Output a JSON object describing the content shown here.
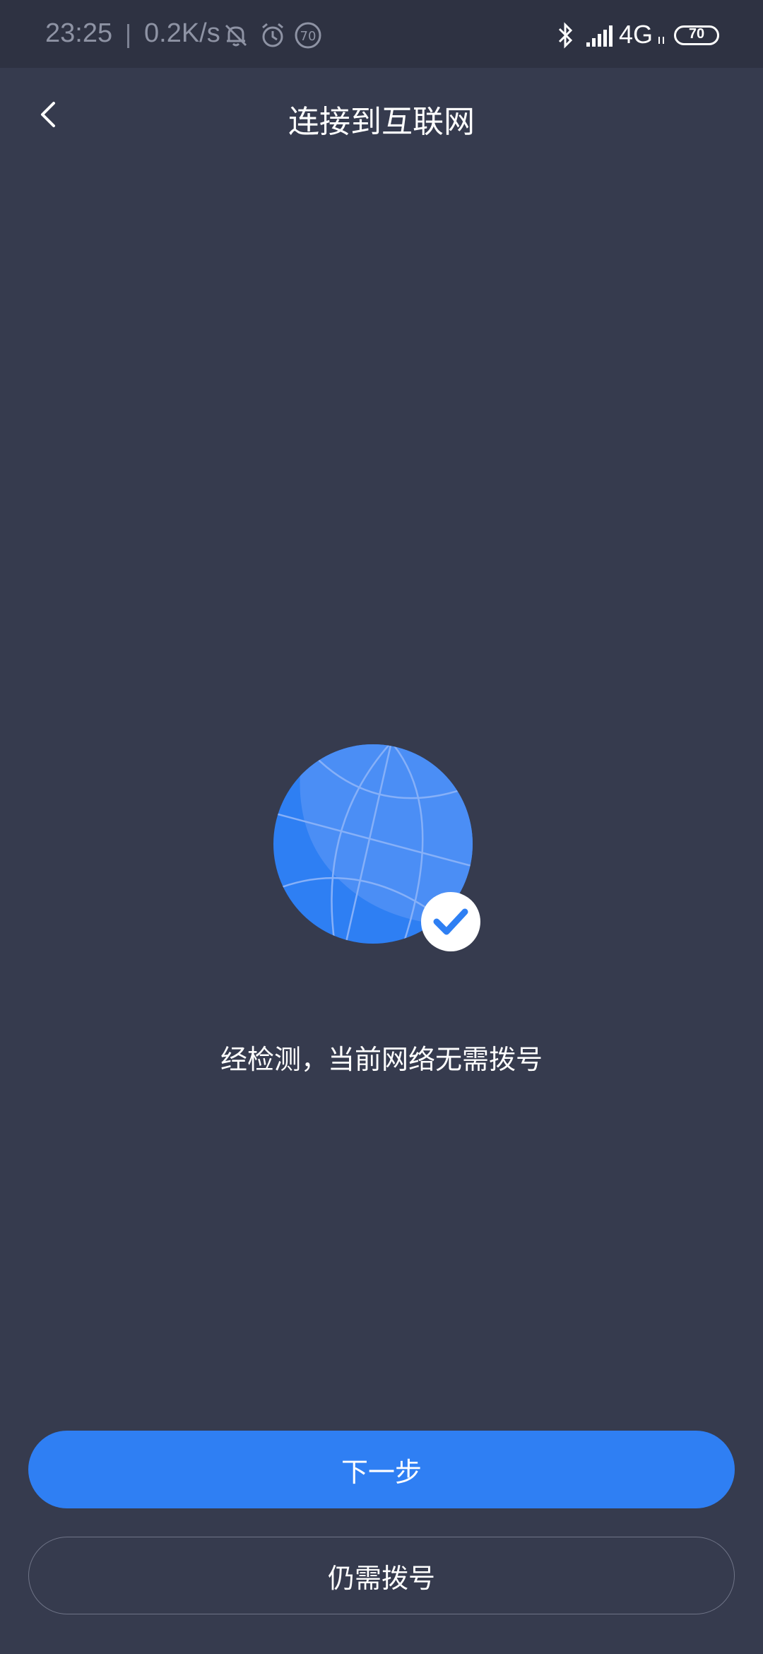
{
  "status_bar": {
    "time": "23:25",
    "net_speed": "0.2K/s",
    "notif_badge": "70",
    "network_type": "4G",
    "battery": "70"
  },
  "header": {
    "title": "连接到互联网"
  },
  "main": {
    "message": "经检测，当前网络无需拨号"
  },
  "actions": {
    "next_label": "下一步",
    "dial_label": "仍需拨号"
  },
  "colors": {
    "background": "#363b4e",
    "accent": "#2f7ff3"
  }
}
